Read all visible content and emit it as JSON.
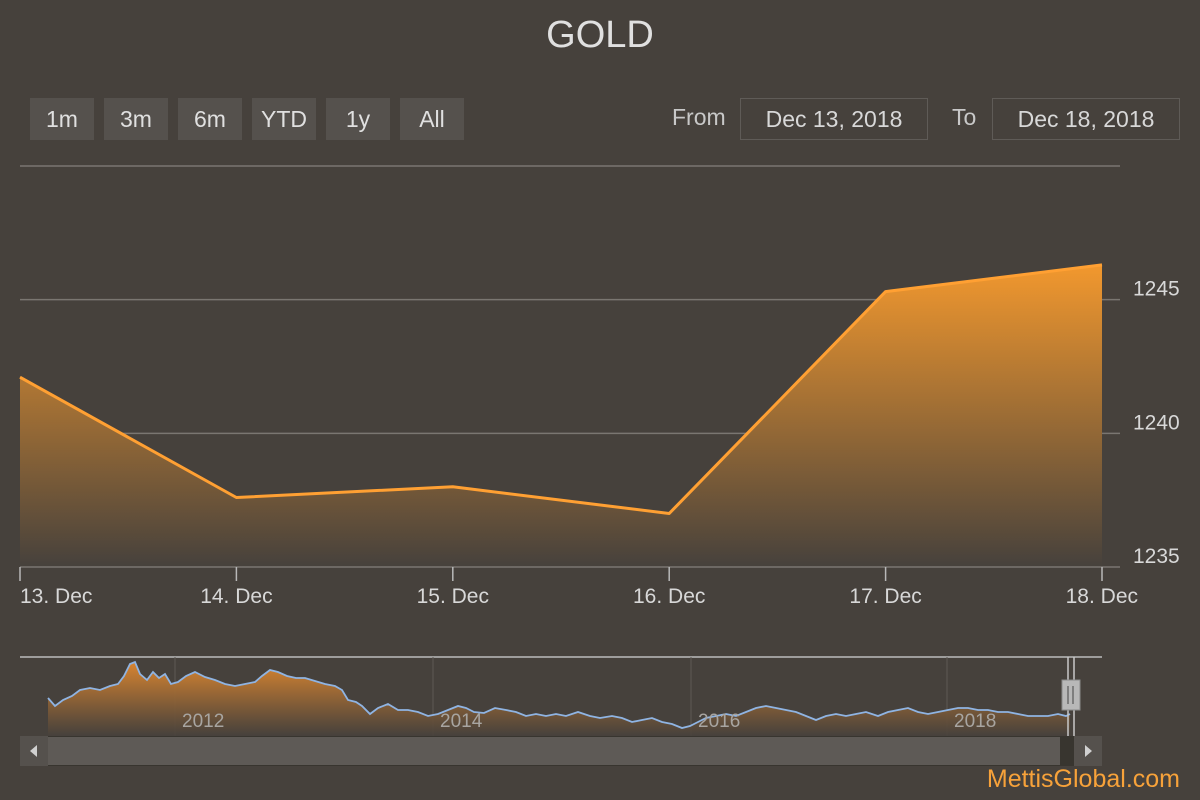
{
  "title": "GOLD",
  "range_selector": {
    "buttons": [
      "1m",
      "3m",
      "6m",
      "YTD",
      "1y",
      "All"
    ],
    "from_label": "From",
    "from_value": "Dec 13, 2018",
    "to_label": "To",
    "to_value": "Dec 18, 2018"
  },
  "chart_data": {
    "type": "area",
    "x": [
      "13. Dec",
      "14. Dec",
      "15. Dec",
      "16. Dec",
      "17. Dec",
      "18. Dec"
    ],
    "values": [
      1242.1,
      1237.6,
      1238.0,
      1237.0,
      1245.3,
      1246.3
    ],
    "ylim": [
      1235,
      1250
    ],
    "yticks": [
      1235,
      1240,
      1245
    ],
    "grid": true,
    "colors": {
      "line": "#ffa033",
      "fill_top": "#f2982e",
      "fill_bottom": "#46413c"
    }
  },
  "navigator": {
    "year_labels": [
      "2012",
      "2014",
      "2016",
      "2018"
    ],
    "colors": {
      "line": "#8fb4e3",
      "fill": "#d98530"
    }
  },
  "watermark": "MettisGlobal.com"
}
